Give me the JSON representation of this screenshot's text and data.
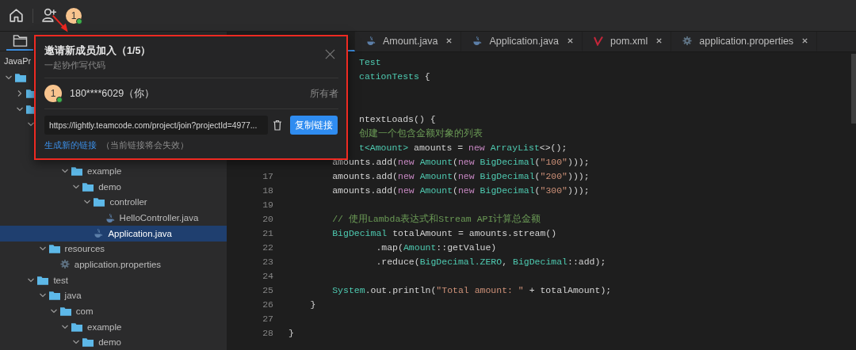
{
  "toolbar": {
    "avatar": {
      "text": "1",
      "online": true
    }
  },
  "sidebar": {
    "tabs": [
      {
        "selected": true
      }
    ],
    "project": "JavaPr",
    "tree": [
      {
        "kind": "folder",
        "expanded": true,
        "selected": false,
        "children": [
          {
            "kind": "folder",
            "expanded": false,
            "selected": false
          },
          {
            "kind": "folder",
            "expanded": true,
            "selected": false,
            "children": [
              {
                "expanded": true,
                "selected": false,
                "children": [
                  {
                    "children": [
                      {
                        "children": [
                          {
                            "label": "example",
                            "kind": "folder",
                            "expanded": true,
                            "selected": false,
                            "children": [
                              {
                                "label": "demo",
                                "kind": "folder",
                                "expanded": true,
                                "selected": false,
                                "children": [
                                  {
                                    "label": "controller",
                                    "kind": "folder",
                                    "expanded": true,
                                    "selected": false,
                                    "children": [
                                      {
                                        "label": "HelloController.java",
                                        "kind": "java",
                                        "selected": false
                                      }
                                    ]
                                  },
                                  {
                                    "label": "Application.java",
                                    "kind": "java",
                                    "selected": true
                                  }
                                ]
                              }
                            ]
                          }
                        ]
                      }
                    ]
                  },
                  {
                    "label": "resources",
                    "kind": "folder",
                    "expanded": true,
                    "selected": false,
                    "children": [
                      {
                        "label": "application.properties",
                        "kind": "properties",
                        "selected": false
                      }
                    ]
                  }
                ]
              },
              {
                "label": "test",
                "kind": "folder",
                "expanded": true,
                "selected": false,
                "children": [
                  {
                    "label": "java",
                    "kind": "folder",
                    "expanded": true,
                    "selected": false,
                    "children": [
                      {
                        "label": "com",
                        "kind": "folder",
                        "expanded": true,
                        "selected": false,
                        "children": [
                          {
                            "label": "example",
                            "kind": "folder",
                            "expanded": true,
                            "selected": false,
                            "children": [
                              {
                                "label": "demo",
                                "kind": "folder",
                                "expanded": true,
                                "selected": false
                              }
                            ]
                          }
                        ]
                      }
                    ]
                  }
                ]
              }
            ]
          }
        ]
      }
    ]
  },
  "editor": {
    "tabs": [
      {
        "selected": true
      },
      {
        "label": "Amount.java",
        "kind": "java",
        "selected": false
      },
      {
        "label": "Application.java",
        "kind": "java",
        "selected": false
      },
      {
        "label": "pom.xml",
        "kind": "maven",
        "selected": false
      },
      {
        "label": "application.properties",
        "kind": "gear",
        "selected": false
      }
    ],
    "lines": [
      {
        "kind": "partial",
        "tokens": [
          {
            "kind": "type",
            "text": "Test"
          }
        ]
      },
      {
        "kind": "partial",
        "tokens": [
          {
            "kind": "type",
            "text": "cationTests"
          },
          {
            "kind": "plain",
            "text": " {"
          }
        ]
      },
      {
        "kind": "partial"
      },
      {
        "kind": "partial"
      },
      {
        "kind": "partial",
        "tokens": [
          {
            "kind": "plain",
            "text": "ntextLoads() {"
          }
        ]
      },
      {
        "kind": "partial",
        "tokens": [
          {
            "kind": "comment",
            "text": "创建一个包含金额对象的列表"
          }
        ]
      },
      {
        "kind": "partial",
        "tokens": [
          {
            "kind": "type",
            "text": "t<Amount>"
          },
          {
            "kind": "plain",
            "text": " amounts = "
          },
          {
            "kind": "keyword",
            "text": "new"
          },
          {
            "kind": "type",
            "text": " ArrayList"
          },
          {
            "kind": "plain",
            "text": "<>();"
          }
        ]
      },
      {
        "kind": "full",
        "tokens": [
          {
            "kind": "plain",
            "text": "        amounts.add("
          },
          {
            "kind": "keyword",
            "text": "new"
          },
          {
            "kind": "type",
            "text": " Amount"
          },
          {
            "kind": "plain",
            "text": "("
          },
          {
            "kind": "keyword",
            "text": "new"
          },
          {
            "kind": "type",
            "text": " BigDecimal"
          },
          {
            "kind": "plain",
            "text": "("
          },
          {
            "kind": "string",
            "text": "\"100\""
          },
          {
            "kind": "plain",
            "text": ")));"
          }
        ]
      },
      {
        "kind": "full",
        "number": "17",
        "tokens": [
          {
            "kind": "plain",
            "text": "        amounts.add("
          },
          {
            "kind": "keyword",
            "text": "new"
          },
          {
            "kind": "type",
            "text": " Amount"
          },
          {
            "kind": "plain",
            "text": "("
          },
          {
            "kind": "keyword",
            "text": "new"
          },
          {
            "kind": "type",
            "text": " BigDecimal"
          },
          {
            "kind": "plain",
            "text": "("
          },
          {
            "kind": "string",
            "text": "\"200\""
          },
          {
            "kind": "plain",
            "text": ")));"
          }
        ]
      },
      {
        "kind": "full",
        "number": "18",
        "tokens": [
          {
            "kind": "plain",
            "text": "        amounts.add("
          },
          {
            "kind": "keyword",
            "text": "new"
          },
          {
            "kind": "type",
            "text": " Amount"
          },
          {
            "kind": "plain",
            "text": "("
          },
          {
            "kind": "keyword",
            "text": "new"
          },
          {
            "kind": "type",
            "text": " BigDecimal"
          },
          {
            "kind": "plain",
            "text": "("
          },
          {
            "kind": "string",
            "text": "\"300\""
          },
          {
            "kind": "plain",
            "text": ")));"
          }
        ]
      },
      {
        "kind": "full",
        "number": "19"
      },
      {
        "kind": "full",
        "number": "20",
        "tokens": [
          {
            "kind": "comment",
            "text": "        // 使用Lambda表达式和Stream API计算总金额"
          }
        ]
      },
      {
        "kind": "full",
        "number": "21",
        "tokens": [
          {
            "kind": "type",
            "text": "        BigDecimal"
          },
          {
            "kind": "plain",
            "text": " totalAmount = amounts.stream()"
          }
        ]
      },
      {
        "kind": "full",
        "number": "22",
        "tokens": [
          {
            "kind": "plain",
            "text": "                .map("
          },
          {
            "kind": "type",
            "text": "Amount"
          },
          {
            "kind": "plain",
            "text": "::getValue)"
          }
        ]
      },
      {
        "kind": "full",
        "number": "23",
        "tokens": [
          {
            "kind": "plain",
            "text": "                .reduce("
          },
          {
            "kind": "type",
            "text": "BigDecimal.ZERO"
          },
          {
            "kind": "plain",
            "text": ", "
          },
          {
            "kind": "type",
            "text": "BigDecimal"
          },
          {
            "kind": "plain",
            "text": "::add);"
          }
        ]
      },
      {
        "kind": "full",
        "number": "24"
      },
      {
        "kind": "full",
        "number": "25",
        "tokens": [
          {
            "kind": "type",
            "text": "        System"
          },
          {
            "kind": "plain",
            "text": ".out.println("
          },
          {
            "kind": "string",
            "text": "\"Total amount: \""
          },
          {
            "kind": "plain",
            "text": " + totalAmount);"
          }
        ]
      },
      {
        "kind": "full",
        "number": "26",
        "tokens": [
          {
            "kind": "plain",
            "text": "    }"
          }
        ]
      },
      {
        "kind": "full",
        "number": "27"
      },
      {
        "kind": "full",
        "number": "28",
        "tokens": [
          {
            "kind": "plain",
            "text": "}"
          }
        ]
      }
    ]
  },
  "invite_popup": {
    "title": "邀请新成员加入（1/5）",
    "subtitle": "一起协作写代码",
    "members": [
      {
        "avatar": "1",
        "online": true,
        "name": "180****6029（你）",
        "role": "所有者"
      }
    ],
    "link": "https://lightly.teamcode.com/project/join?projectId=4977...",
    "copy_button": "复制链接",
    "regenerate_link": "生成新的链接",
    "regenerate_note": "（当前链接将会失效）"
  }
}
